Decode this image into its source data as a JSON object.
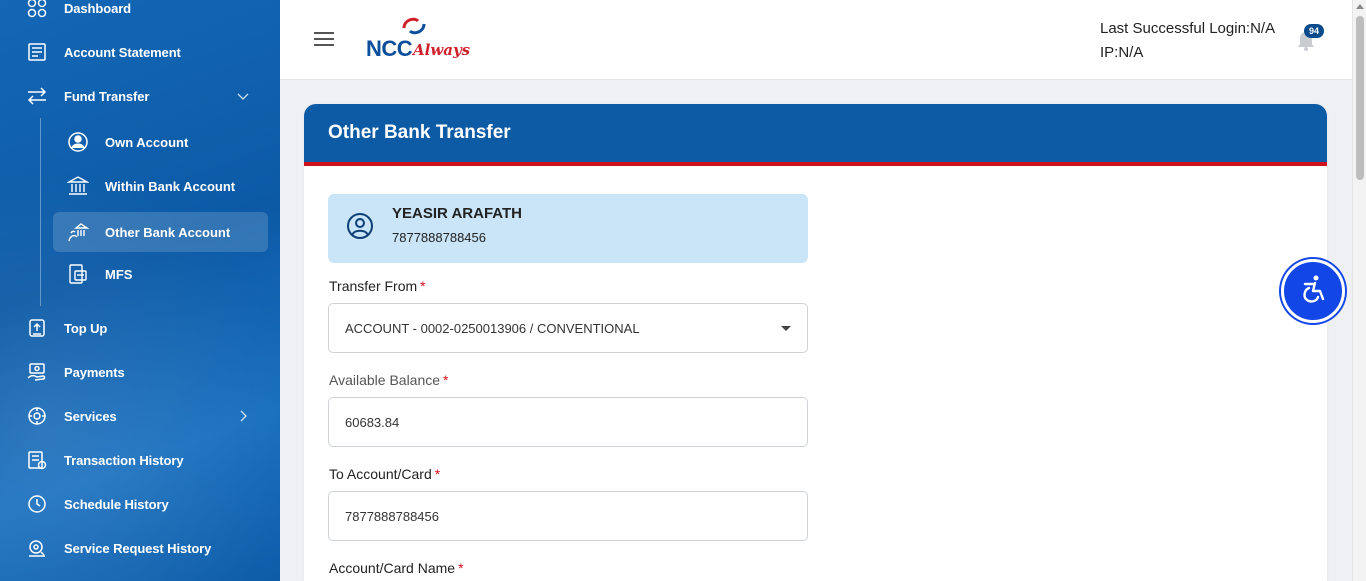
{
  "sidebar": {
    "items": [
      {
        "label": "Dashboard",
        "icon": "dashboard-icon"
      },
      {
        "label": "Account Statement",
        "icon": "statement-icon"
      },
      {
        "label": "Fund Transfer",
        "icon": "transfer-icon",
        "expanded": true
      },
      {
        "label": "Top Up",
        "icon": "topup-icon"
      },
      {
        "label": "Payments",
        "icon": "payments-icon"
      },
      {
        "label": "Services",
        "icon": "services-icon"
      },
      {
        "label": "Transaction History",
        "icon": "transaction-history-icon"
      },
      {
        "label": "Schedule History",
        "icon": "clock-icon"
      },
      {
        "label": "Service Request History",
        "icon": "service-request-icon"
      }
    ],
    "fund_transfer_sub": [
      {
        "label": "Own Account",
        "icon": "own-account-icon"
      },
      {
        "label": "Within Bank Account",
        "icon": "bank-icon"
      },
      {
        "label": "Other Bank Account",
        "icon": "other-bank-icon",
        "active": true
      },
      {
        "label": "MFS",
        "icon": "mfs-icon"
      }
    ]
  },
  "header": {
    "logo_main": "NCC",
    "logo_script": "Always",
    "last_login": "Last Successful Login:N/A",
    "ip": "IP:N/A",
    "notification_count": "94"
  },
  "page": {
    "title": "Other Bank Transfer",
    "user": {
      "name": "YEASIR ARAFATH",
      "account": "7877888788456"
    },
    "form": {
      "transfer_from_label": "Transfer From",
      "transfer_from_value": "ACCOUNT - 0002-0250013906 / CONVENTIONAL",
      "available_balance_label": "Available Balance",
      "available_balance_value": "60683.84",
      "to_account_label": "To Account/Card",
      "to_account_value": "7877888788456",
      "account_name_label": "Account/Card Name",
      "required_mark": "*"
    }
  },
  "colors": {
    "primary": "#0d5aa5",
    "accent_red": "#d0101c",
    "user_box": "#c9e5f7",
    "a11y": "#1246e6"
  }
}
